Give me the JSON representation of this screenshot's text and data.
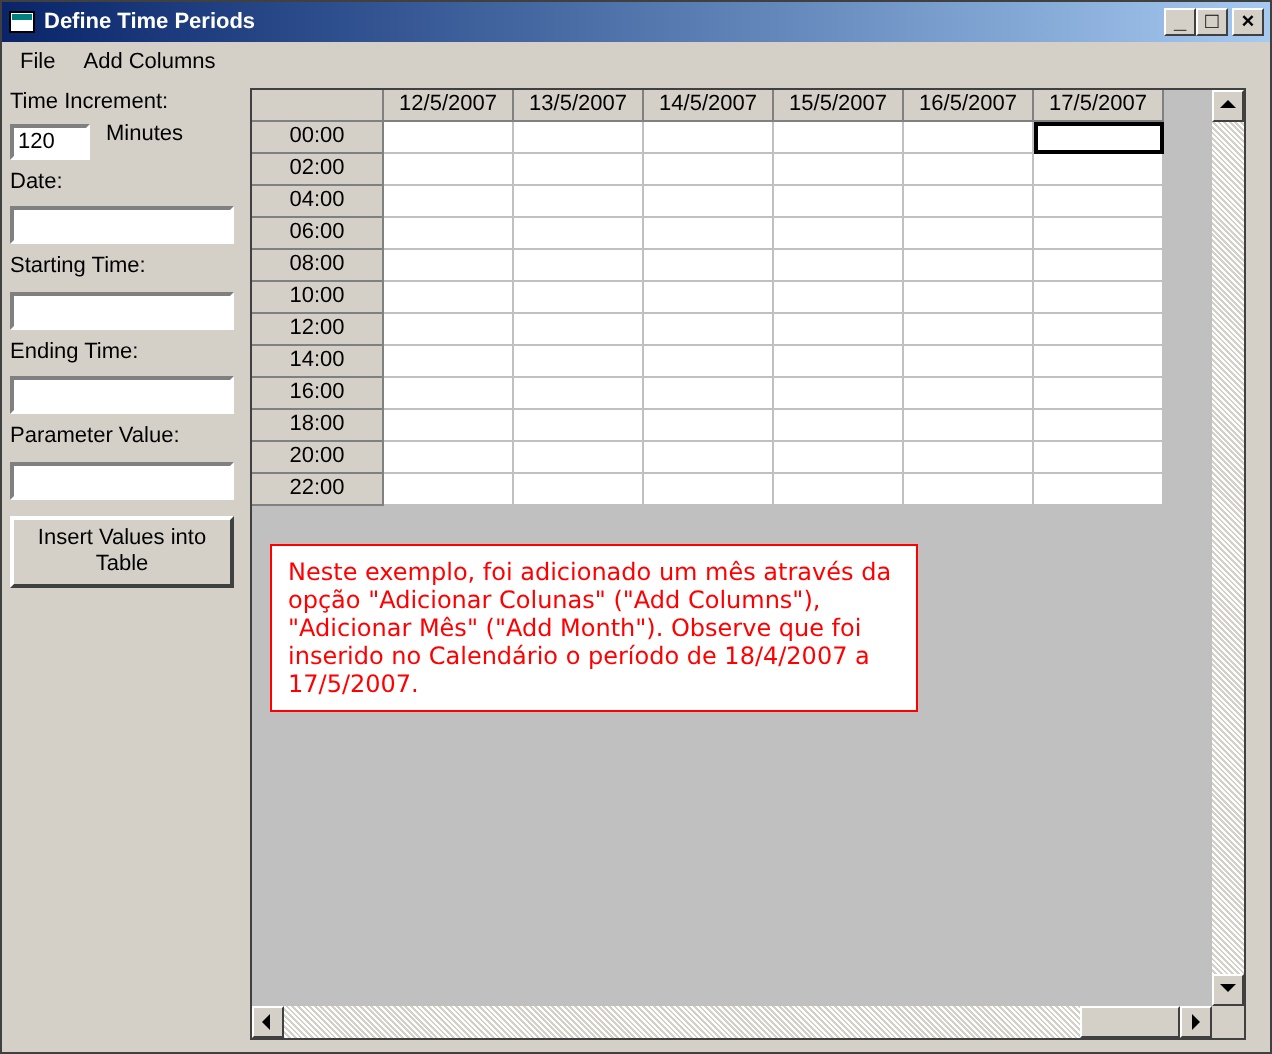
{
  "window": {
    "title": "Define Time Periods",
    "controls": [
      "_",
      "□",
      "×"
    ]
  },
  "menu": [
    "File",
    "Add Columns"
  ],
  "form": {
    "increment_label": "Time Increment:",
    "increment_value": "120",
    "increment_unit": "Minutes",
    "fields": [
      {
        "label": "Date:"
      },
      {
        "label": "Starting Time:"
      },
      {
        "label": "Ending Time:"
      },
      {
        "label": "Parameter Value:"
      }
    ],
    "button": "Insert Values into Table"
  },
  "table": {
    "columns": [
      "12/5/2007",
      "13/5/2007",
      "14/5/2007",
      "15/5/2007",
      "16/5/2007",
      "17/5/2007"
    ],
    "rows": [
      {
        "label": "00:00",
        "cells": [
          {
            "selected": false
          },
          {
            "selected": false
          },
          {
            "selected": false
          },
          {
            "selected": false
          },
          {
            "selected": false
          },
          {
            "selected": true
          }
        ]
      },
      {
        "label": "02:00",
        "cells": [
          {
            "selected": false
          },
          {
            "selected": false
          },
          {
            "selected": false
          },
          {
            "selected": false
          },
          {
            "selected": false
          },
          {
            "selected": false
          }
        ]
      },
      {
        "label": "04:00",
        "cells": [
          {
            "selected": false
          },
          {
            "selected": false
          },
          {
            "selected": false
          },
          {
            "selected": false
          },
          {
            "selected": false
          },
          {
            "selected": false
          }
        ]
      },
      {
        "label": "06:00",
        "cells": [
          {
            "selected": false
          },
          {
            "selected": false
          },
          {
            "selected": false
          },
          {
            "selected": false
          },
          {
            "selected": false
          },
          {
            "selected": false
          }
        ]
      },
      {
        "label": "08:00",
        "cells": [
          {
            "selected": false
          },
          {
            "selected": false
          },
          {
            "selected": false
          },
          {
            "selected": false
          },
          {
            "selected": false
          },
          {
            "selected": false
          }
        ]
      },
      {
        "label": "10:00",
        "cells": [
          {
            "selected": false
          },
          {
            "selected": false
          },
          {
            "selected": false
          },
          {
            "selected": false
          },
          {
            "selected": false
          },
          {
            "selected": false
          }
        ]
      },
      {
        "label": "12:00",
        "cells": [
          {
            "selected": false
          },
          {
            "selected": false
          },
          {
            "selected": false
          },
          {
            "selected": false
          },
          {
            "selected": false
          },
          {
            "selected": false
          }
        ]
      },
      {
        "label": "14:00",
        "cells": [
          {
            "selected": false
          },
          {
            "selected": false
          },
          {
            "selected": false
          },
          {
            "selected": false
          },
          {
            "selected": false
          },
          {
            "selected": false
          }
        ]
      },
      {
        "label": "16:00",
        "cells": [
          {
            "selected": false
          },
          {
            "selected": false
          },
          {
            "selected": false
          },
          {
            "selected": false
          },
          {
            "selected": false
          },
          {
            "selected": false
          }
        ]
      },
      {
        "label": "18:00",
        "cells": [
          {
            "selected": false
          },
          {
            "selected": false
          },
          {
            "selected": false
          },
          {
            "selected": false
          },
          {
            "selected": false
          },
          {
            "selected": false
          }
        ]
      },
      {
        "label": "20:00",
        "cells": [
          {
            "selected": false
          },
          {
            "selected": false
          },
          {
            "selected": false
          },
          {
            "selected": false
          },
          {
            "selected": false
          },
          {
            "selected": false
          }
        ]
      },
      {
        "label": "22:00",
        "cells": [
          {
            "selected": false
          },
          {
            "selected": false
          },
          {
            "selected": false
          },
          {
            "selected": false
          },
          {
            "selected": false
          },
          {
            "selected": false
          }
        ]
      }
    ]
  },
  "note": "Neste exemplo, foi adicionado um mês através da opção \"Adicionar Colunas\" (\"Add Columns\"), \"Adicionar Mês\" (\"Add Month\"). Observe que foi inserido no Calendário o período de 18/4/2007 a 17/5/2007."
}
